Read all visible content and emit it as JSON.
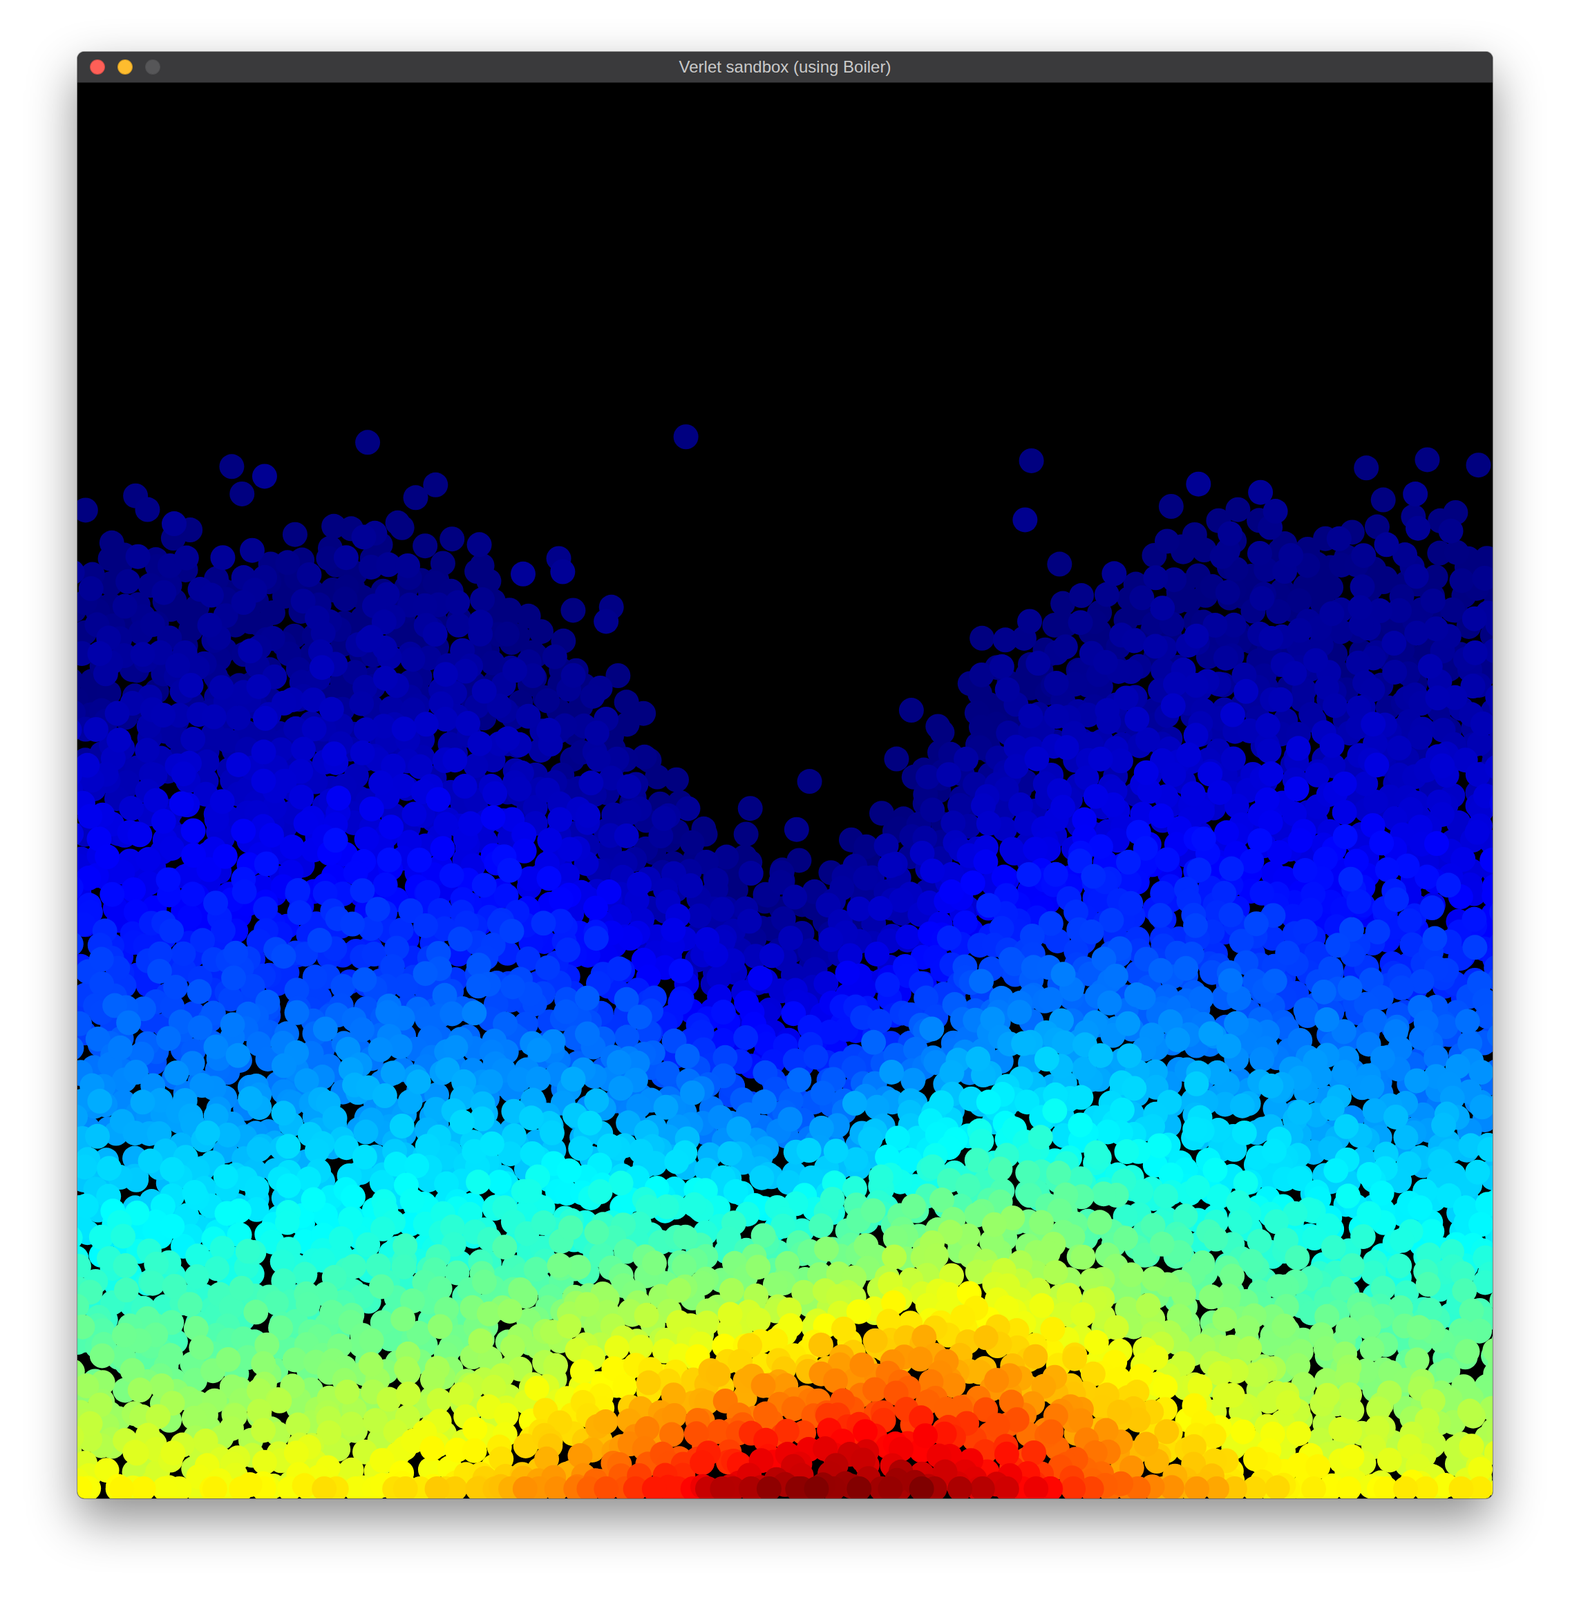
{
  "window": {
    "title": "Verlet sandbox (using Boiler)"
  },
  "buttons": [
    {
      "name": "close",
      "color": "#fe5f57",
      "disabled": false
    },
    {
      "name": "minimize",
      "color": "#febc2e",
      "disabled": false
    },
    {
      "name": "zoom",
      "color": "#5c5c5e",
      "disabled": true
    }
  ]
}
